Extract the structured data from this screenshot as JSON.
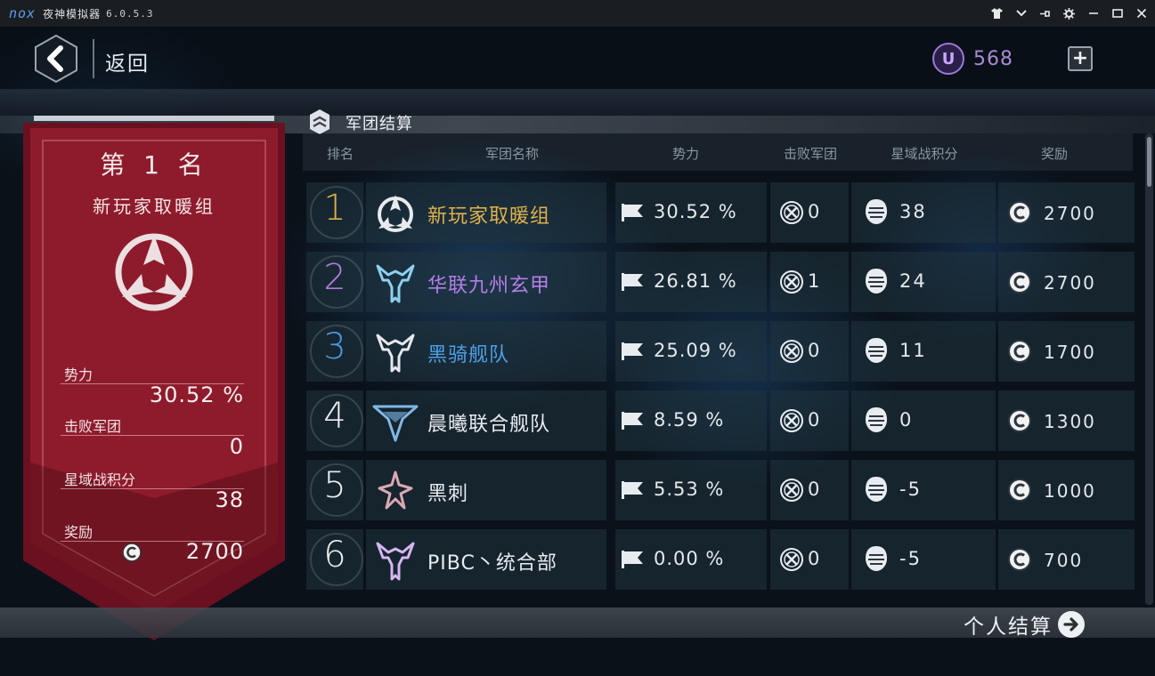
{
  "emulator": {
    "logo": "nox",
    "app_name": "夜神模拟器",
    "version": "6.0.5.3",
    "controls": [
      "tshirt-icon",
      "chevron-down-icon",
      "pin-icon",
      "gear-icon",
      "minimize-icon",
      "maximize-icon",
      "close-icon"
    ]
  },
  "header": {
    "back_label": "返回",
    "currency_symbol": "U",
    "currency_value": "568"
  },
  "section": {
    "title": "军团结算"
  },
  "winner_banner": {
    "rank_title": "第 1 名",
    "team_name": "新玩家取暖组",
    "stats": [
      {
        "label": "势力",
        "value": "30.52 %"
      },
      {
        "label": "击败军团",
        "value": "0"
      },
      {
        "label": "星域战积分",
        "value": "38"
      },
      {
        "label": "奖励",
        "value": "2700"
      }
    ],
    "colors": {
      "banner": "#8e1b2c",
      "banner_dark": "#6a1020"
    }
  },
  "table": {
    "headers": [
      "排名",
      "军团名称",
      "势力",
      "击败军团",
      "星域战积分",
      "奖励"
    ],
    "rows": [
      {
        "rank": "1",
        "name": "新玩家取暖组",
        "power": "30.52 %",
        "defeated": "0",
        "score": "38",
        "reward": "2700",
        "rank_color": "#d9b04a",
        "name_color": "#e0b24a",
        "icon": "tri-blade-emblem-icon"
      },
      {
        "rank": "2",
        "name": "华联九州玄甲",
        "power": "26.81 %",
        "defeated": "1",
        "score": "24",
        "reward": "2700",
        "rank_color": "#b07ae0",
        "name_color": "#b47ee6",
        "icon": "horned-emblem-icon"
      },
      {
        "rank": "3",
        "name": "黑骑舰队",
        "power": "25.09 %",
        "defeated": "0",
        "score": "11",
        "reward": "1700",
        "rank_color": "#4a9be0",
        "name_color": "#4d9fe6",
        "icon": "horned-emblem-icon"
      },
      {
        "rank": "4",
        "name": "晨曦联合舰队",
        "power": "8.59 %",
        "defeated": "0",
        "score": "0",
        "reward": "1300",
        "rank_color": "#e8ecf0",
        "name_color": "#e8ecf0",
        "icon": "wing-emblem-icon"
      },
      {
        "rank": "5",
        "name": "黑刺",
        "power": "5.53 %",
        "defeated": "0",
        "score": "-5",
        "reward": "1000",
        "rank_color": "#e8ecf0",
        "name_color": "#e8ecf0",
        "icon": "thorn-emblem-icon"
      },
      {
        "rank": "6",
        "name": "PIBC丶统合部",
        "power": "0.00 %",
        "defeated": "0",
        "score": "-5",
        "reward": "700",
        "rank_color": "#e8ecf0",
        "name_color": "#e8ecf0",
        "icon": "horned-emblem-icon"
      }
    ]
  },
  "footer": {
    "personal_label": "个人结算"
  }
}
